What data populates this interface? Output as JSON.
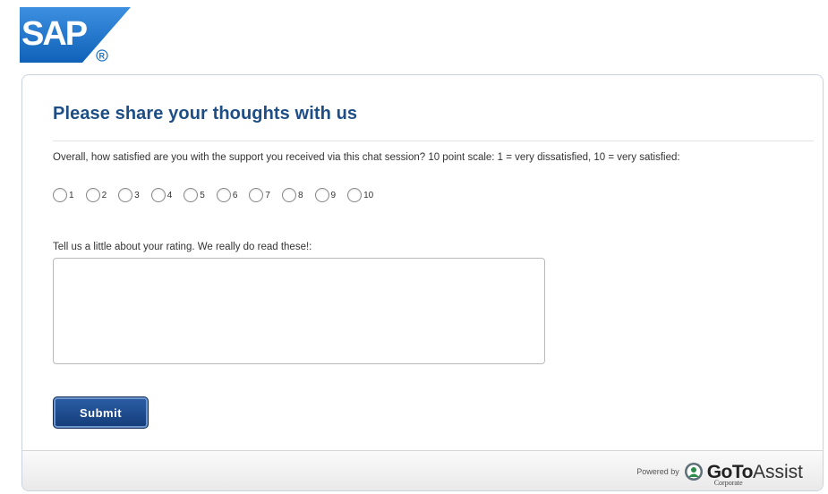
{
  "logo": {
    "text": "SAP",
    "registered": "®",
    "color": "#1a73c6"
  },
  "form": {
    "title": "Please share your thoughts with us",
    "question": "Overall, how satisfied are you with the support you received via this chat session? 10 point scale: 1 = very dissatisfied, 10 = very satisfied:",
    "scale_options": [
      "1",
      "2",
      "3",
      "4",
      "5",
      "6",
      "7",
      "8",
      "9",
      "10"
    ],
    "selected": null,
    "comment_label": "Tell us a little about your rating. We really do read these!:",
    "comment_value": "",
    "submit_label": "Submit"
  },
  "footer": {
    "powered_by": "Powered by",
    "brand_goto": "GoTo",
    "brand_assist": "Assist",
    "brand_tier": "Corporate"
  },
  "colors": {
    "title": "#1d4e86",
    "submit": "#1a4584"
  }
}
